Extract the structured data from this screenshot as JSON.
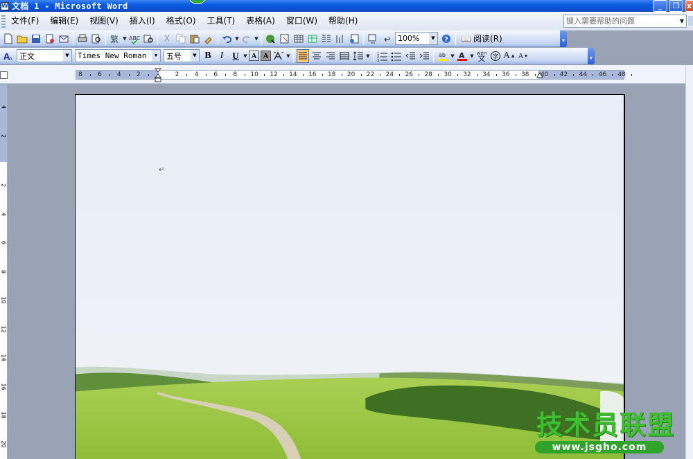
{
  "window": {
    "title": "文档 1 - Microsoft Word",
    "app_icon_glyph": "W",
    "buttons": {
      "minimize": "_",
      "maximize": "❐",
      "close": "x"
    }
  },
  "menubar": {
    "items": [
      "文件(F)",
      "编辑(E)",
      "视图(V)",
      "插入(I)",
      "格式(O)",
      "工具(T)",
      "表格(A)",
      "窗口(W)",
      "帮助(H)"
    ],
    "help_placeholder": "键入需要帮助的问题"
  },
  "standard_toolbar": {
    "zoom": "100%",
    "read_label": "阅读(R)"
  },
  "formatting_toolbar": {
    "style": "正文",
    "font": "Times New Roman",
    "size": "五号",
    "bold": "B",
    "italic": "I",
    "underline": "U",
    "char_border": "A",
    "char_shading": "A",
    "grow_font": "A",
    "shrink_font": "A",
    "phonetic_label": "wén",
    "enclose_label": "字"
  },
  "ruler": {
    "numbers": [
      "8",
      "6",
      "4",
      "2",
      "2",
      "4",
      "6",
      "8",
      "10",
      "12",
      "14",
      "16",
      "18",
      "20",
      "22",
      "24",
      "26",
      "28",
      "30",
      "32",
      "34",
      "36",
      "38",
      "40",
      "42",
      "44",
      "46",
      "48"
    ]
  },
  "vruler": {
    "numbers": [
      "4",
      "2",
      "2",
      "4",
      "6",
      "8",
      "10",
      "12",
      "14",
      "16",
      "18",
      "20"
    ]
  },
  "document": {
    "paragraph_mark": "↵"
  },
  "watermark": {
    "title": "技术员联盟",
    "url": "www.jsgho.com"
  },
  "colors": {
    "title_bar": "#0a5ae0",
    "menubar": "#dde4f3",
    "workspace": "#9aa3b6",
    "watermark_green": "#3fbf2f"
  }
}
